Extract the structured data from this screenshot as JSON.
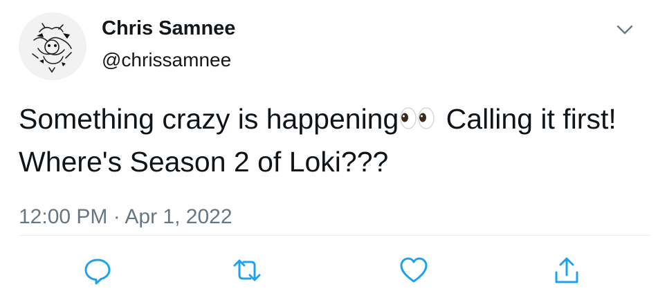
{
  "tweet": {
    "author": {
      "display_name": "Chris Samnee",
      "handle": "@chrissamnee",
      "avatar_icon": "sketch-avatar"
    },
    "text_before_emoji": "Something crazy is happening",
    "emoji": "eyes-emoji",
    "text_after_emoji": " Calling it first! Where's Season 2 of Loki???",
    "timestamp": "12:00 PM · Apr 1, 2022",
    "actions": [
      {
        "icon": "reply-icon"
      },
      {
        "icon": "retweet-icon"
      },
      {
        "icon": "like-icon"
      },
      {
        "icon": "share-icon"
      }
    ]
  },
  "colors": {
    "text": "#14171a",
    "secondary": "#657786",
    "icon": "#1da1f2",
    "divider": "#e6ecf0"
  }
}
